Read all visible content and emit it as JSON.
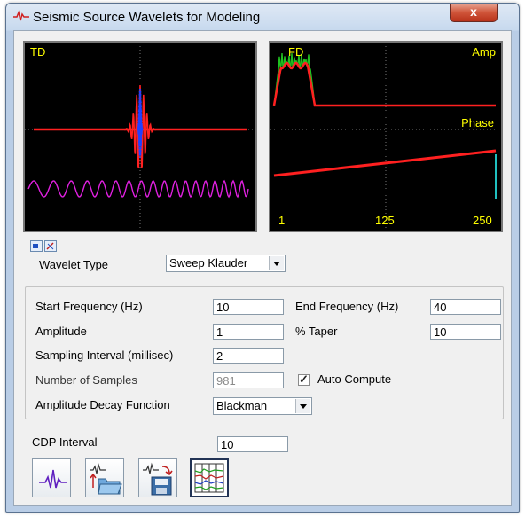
{
  "window": {
    "title": "Seismic Source Wavelets for Modeling",
    "close_label": "x"
  },
  "plots": {
    "time": {
      "label": "TD"
    },
    "freq": {
      "label": "FD",
      "amp_label": "Amp",
      "phase_label": "Phase",
      "x_ticks": [
        "1",
        "125",
        "250"
      ]
    }
  },
  "icons": {
    "window_icon": "waveform-icon",
    "plot_toggle_1": "screen-icon",
    "plot_toggle_2": "pin-icon",
    "tool_1": "wavelet-icon",
    "tool_2": "open-folder-icon",
    "tool_3": "save-disk-icon",
    "tool_4": "grid-traces-icon"
  },
  "colors": {
    "trace_red": "#ff2020",
    "trace_blue": "#2040ff",
    "sweep_magenta": "#e020e0",
    "amp_green": "#20c020",
    "label_yellow": "#ffff00",
    "phase_cyan": "#20c0c0"
  },
  "form": {
    "wavelet_type": {
      "label": "Wavelet Type",
      "value": "Sweep Klauder"
    },
    "start_frequency": {
      "label": "Start Frequency (Hz)",
      "value": "10"
    },
    "end_frequency": {
      "label": "End Frequency (Hz)",
      "value": "40"
    },
    "amplitude": {
      "label": "Amplitude",
      "value": "1"
    },
    "taper": {
      "label": "% Taper",
      "value": "10"
    },
    "sampling_interval": {
      "label": "Sampling Interval (millisec)",
      "value": "2"
    },
    "num_samples": {
      "label": "Number of Samples",
      "value": "981"
    },
    "auto_compute": {
      "label": "Auto Compute",
      "checked": true
    },
    "decay_function": {
      "label": "Amplitude Decay Function",
      "value": "Blackman"
    },
    "cdp_interval": {
      "label": "CDP Interval",
      "value": "10"
    }
  }
}
